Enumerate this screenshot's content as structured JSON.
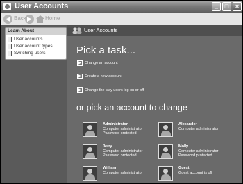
{
  "window": {
    "title": "User Accounts",
    "controls": {
      "minimize": "_",
      "maximize": "□",
      "close": "×"
    }
  },
  "toolbar": {
    "back_label": "Back",
    "home_label": "Home"
  },
  "learn_about": {
    "title": "Learn About",
    "items": [
      {
        "label": "User accounts",
        "icon": "document-icon"
      },
      {
        "label": "User account types",
        "icon": "document-icon"
      },
      {
        "label": "Switching users",
        "icon": "document-icon"
      }
    ]
  },
  "main": {
    "header_title": "User Accounts",
    "pick_task": "Pick a task...",
    "tasks": [
      {
        "label": "Change an account"
      },
      {
        "label": "Create a new account"
      },
      {
        "label": "Change the way users log on or off"
      }
    ],
    "pick_account": "or pick an account to change",
    "accounts": [
      {
        "name": "Administrator",
        "lines": [
          "Computer administrator",
          "Password protected"
        ]
      },
      {
        "name": "Alexander",
        "lines": [
          "Computer administrator"
        ]
      },
      {
        "name": "Jerry",
        "lines": [
          "Computer administrator",
          "Password protected"
        ]
      },
      {
        "name": "Molly",
        "lines": [
          "Computer administrator",
          "Password protected"
        ]
      },
      {
        "name": "William",
        "lines": [
          "Computer administrator"
        ]
      },
      {
        "name": "Guest",
        "lines": [
          "Guest account is off"
        ]
      }
    ]
  }
}
